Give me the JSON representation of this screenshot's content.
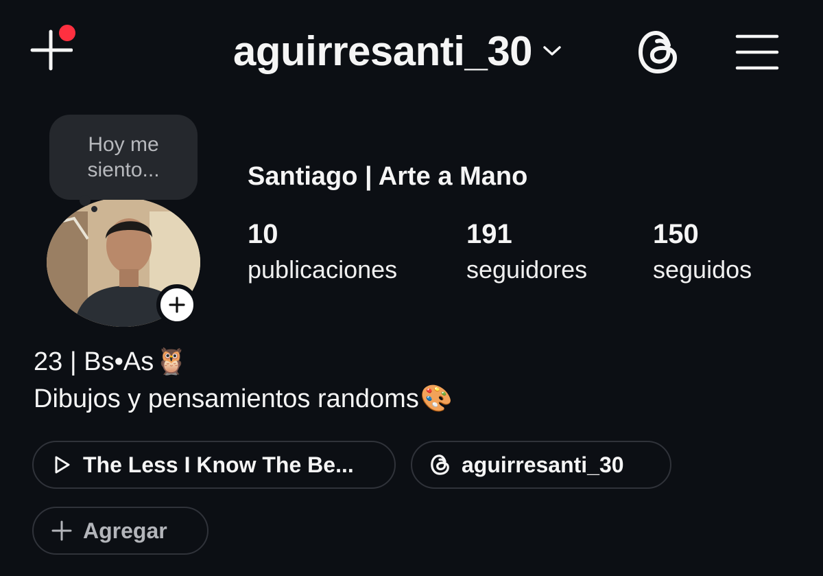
{
  "header": {
    "username": "aguirresanti_30",
    "has_notification": true,
    "colors": {
      "notification_dot": "#ff3040",
      "background": "#0c0f14"
    },
    "icons": {
      "new_post": "plus-icon",
      "account_switch": "chevron-down-icon",
      "threads": "threads-icon",
      "menu": "hamburger-menu-icon"
    }
  },
  "profile": {
    "note": "Hoy me\nsiento...",
    "display_name": "Santiago | Arte a Mano",
    "stats": {
      "posts": {
        "value": "10",
        "label": "publicaciones"
      },
      "followers": {
        "value": "191",
        "label": "seguidores"
      },
      "following": {
        "value": "150",
        "label": "seguidos"
      }
    }
  },
  "bio": {
    "line1": "23 | Bs•As",
    "line1_emoji": "🦉",
    "line2": "Dibujos y pensamientos randoms",
    "line2_emoji": "🎨"
  },
  "links": {
    "music": {
      "icon": "play-icon",
      "label": "The Less I Know The Be..."
    },
    "threads": {
      "icon": "threads-icon",
      "label": "aguirresanti_30"
    },
    "add": {
      "icon": "plus-icon",
      "label": "Agregar"
    }
  }
}
